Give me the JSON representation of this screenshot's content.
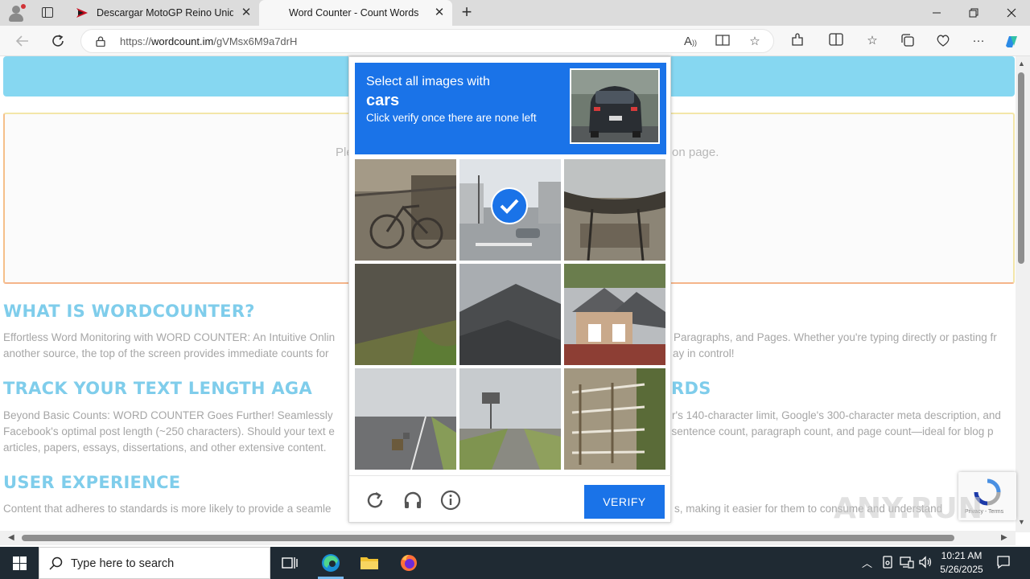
{
  "browser": {
    "tabs": [
      {
        "title": "Descargar MotoGP Reino Unido",
        "active": false
      },
      {
        "title": "Word Counter - Count Words",
        "active": true
      }
    ],
    "url_prefix": "https://",
    "url_domain": "wordcount.im",
    "url_path": "/gVMsx6M9a7drH"
  },
  "page": {
    "hint_left": "Ple",
    "hint_right": "on page.",
    "section1": {
      "heading": "WHAT IS WORDCOUNTER?",
      "line1_left": "Effortless Word Monitoring with WORD COUNTER: An Intuitive Onlin",
      "line1_right": "Paragraphs, and Pages. Whether you're typing directly or pasting fr",
      "line2_left": "another source, the top of the screen provides immediate counts for",
      "line2_right": "ay in control!"
    },
    "section2": {
      "heading_left": "TRACK YOUR TEXT LENGTH AGA",
      "heading_right": "RDS",
      "line1_left": "Beyond Basic Counts: WORD COUNTER Goes Further! Seamlessly",
      "line1_right": "r's 140-character limit, Google's 300-character meta description, and",
      "line2_left": "Facebook's optimal post length (~250 characters). Should your text e",
      "line2_right": "-sentence count, paragraph count, and page count—ideal for blog p",
      "line3_left": "articles, papers, essays, dissertations, and other extensive content."
    },
    "section3": {
      "heading": "USER EXPERIENCE",
      "line1_left": "Content that adheres to standards is more likely to provide a seamle",
      "line1_right": "s, making it easier for them to consume and understand"
    }
  },
  "captcha": {
    "instruction": "Select all images with",
    "target": "cars",
    "subtext": "Click verify once there are none left",
    "tiles": [
      {
        "subject": "bicycle-noisy",
        "selected": false
      },
      {
        "subject": "street-with-car",
        "selected": true
      },
      {
        "subject": "vehicle-interior-noisy",
        "selected": false
      },
      {
        "subject": "roof-noisy",
        "selected": false
      },
      {
        "subject": "roof",
        "selected": false
      },
      {
        "subject": "house",
        "selected": false
      },
      {
        "subject": "highway",
        "selected": false
      },
      {
        "subject": "road-billboard",
        "selected": false
      },
      {
        "subject": "fence",
        "selected": false
      }
    ],
    "verify_label": "VERIFY"
  },
  "recaptcha_badge": {
    "terms": "Privacy - Terms"
  },
  "watermark": "ANY.RUN",
  "taskbar": {
    "search_placeholder": "Type here to search",
    "time": "10:21 AM",
    "date": "5/26/2025"
  },
  "colors": {
    "captcha_blue": "#1a73e8",
    "site_heading": "#7fcdeb",
    "site_banner": "#86d7f1"
  }
}
